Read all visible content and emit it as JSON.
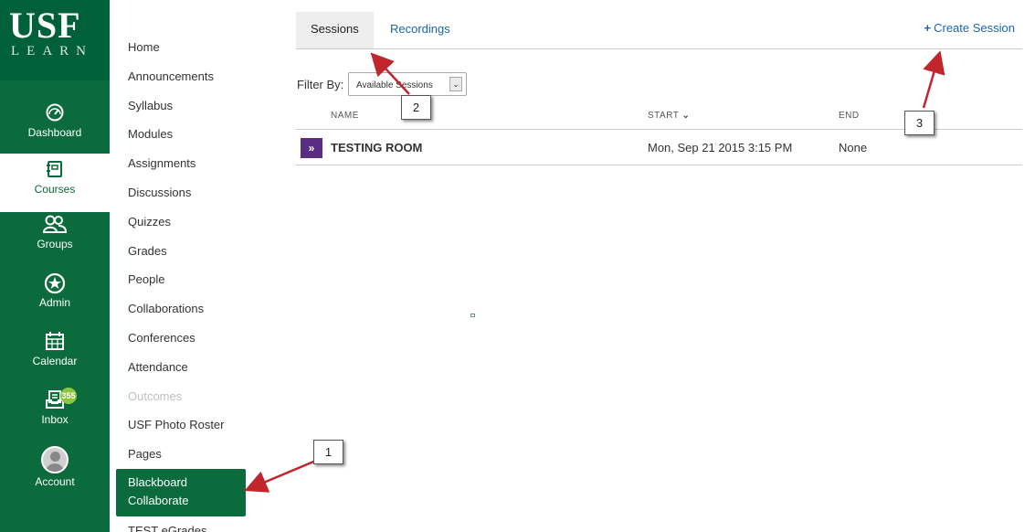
{
  "logo": {
    "top": "USF",
    "bottom": "LEARN"
  },
  "global_nav": [
    {
      "label": "Dashboard",
      "icon": "dashboard-icon"
    },
    {
      "label": "Courses",
      "icon": "courses-icon",
      "active": true
    },
    {
      "label": "Groups",
      "icon": "groups-icon"
    },
    {
      "label": "Admin",
      "icon": "admin-icon"
    },
    {
      "label": "Calendar",
      "icon": "calendar-icon"
    },
    {
      "label": "Inbox",
      "icon": "inbox-icon",
      "badge": "355"
    },
    {
      "label": "Account",
      "icon": "avatar"
    }
  ],
  "course_nav": [
    "Home",
    "Announcements",
    "Syllabus",
    "Modules",
    "Assignments",
    "Discussions",
    "Quizzes",
    "Grades",
    "People",
    "Collaborations",
    "Conferences",
    "Attendance",
    "Outcomes",
    "USF Photo Roster",
    "Pages",
    "Blackboard Collaborate",
    "TEST eGrades"
  ],
  "course_nav_active_line1": "Blackboard",
  "course_nav_active_line2": "Collaborate",
  "tabs": {
    "sessions": "Sessions",
    "recordings": "Recordings"
  },
  "create_session": {
    "icon": "+",
    "label": "Create Session"
  },
  "filter": {
    "label": "Filter By:",
    "value": "Available Sessions"
  },
  "columns": {
    "name": "NAME",
    "start": "START",
    "end": "END"
  },
  "session": {
    "name": "TESTING ROOM",
    "start": "Mon, Sep 21 2015 3:15 PM",
    "end": "None"
  },
  "callouts": [
    "1",
    "2",
    "3"
  ],
  "colors": {
    "brand_green": "#0c6b3c",
    "link_blue": "#1a66a8",
    "session_purple": "#5a2d82",
    "arrow_red": "#c0262c",
    "badge_green": "#8cc63e"
  }
}
